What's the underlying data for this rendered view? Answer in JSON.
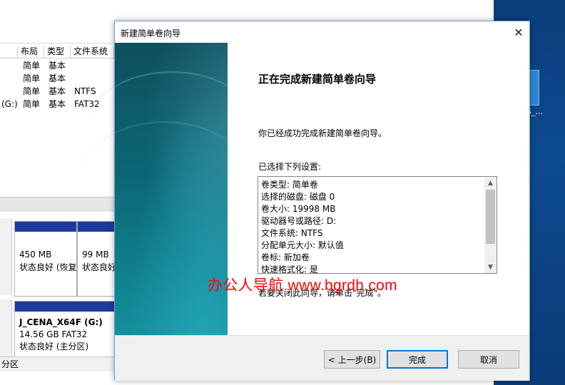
{
  "background": {
    "volume_table": {
      "headers": [
        "布局",
        "类型",
        "文件系统"
      ],
      "rows": [
        {
          "name": "",
          "layout": "简单",
          "type": "基本",
          "fs": ""
        },
        {
          "name": "",
          "layout": "简单",
          "type": "基本",
          "fs": ""
        },
        {
          "name": "",
          "layout": "简单",
          "type": "基本",
          "fs": "NTFS"
        },
        {
          "name": "(G:)",
          "layout": "简单",
          "type": "基本",
          "fs": "FAT32"
        }
      ]
    },
    "disk0": {
      "partitions": [
        {
          "size": "450 MB",
          "status": "状态良好 (恢复"
        },
        {
          "size": "99 MB",
          "status": "状态良好"
        }
      ]
    },
    "disk1": {
      "name": "J_CENA_X64F  (G:)",
      "size": "14.56 GB FAT32",
      "status": "状态良好 (主分区)"
    },
    "status_bar": "分区",
    "desktop_icon_label": "S_..."
  },
  "dialog": {
    "title": "新建简单卷向导",
    "heading": "正在完成新建简单卷向导",
    "success_text": "你已经成功完成新建简单卷向导。",
    "settings_label": "已选择下列设置:",
    "settings": [
      "卷类型: 简单卷",
      "选择的磁盘: 磁盘 0",
      "卷大小: 19998 MB",
      "驱动器号或路径: D:",
      "文件系统: NTFS",
      "分配单元大小: 默认值",
      "卷标: 新加卷",
      "快速格式化: 是"
    ],
    "close_note": "若要关闭此向导，请单击\"完成\"。",
    "watermark": "办公人导航  www.bgrdh.com",
    "buttons": {
      "back": "< 上一步(B)",
      "finish": "完成",
      "cancel": "取消"
    },
    "accent_color": "#0078d7"
  }
}
